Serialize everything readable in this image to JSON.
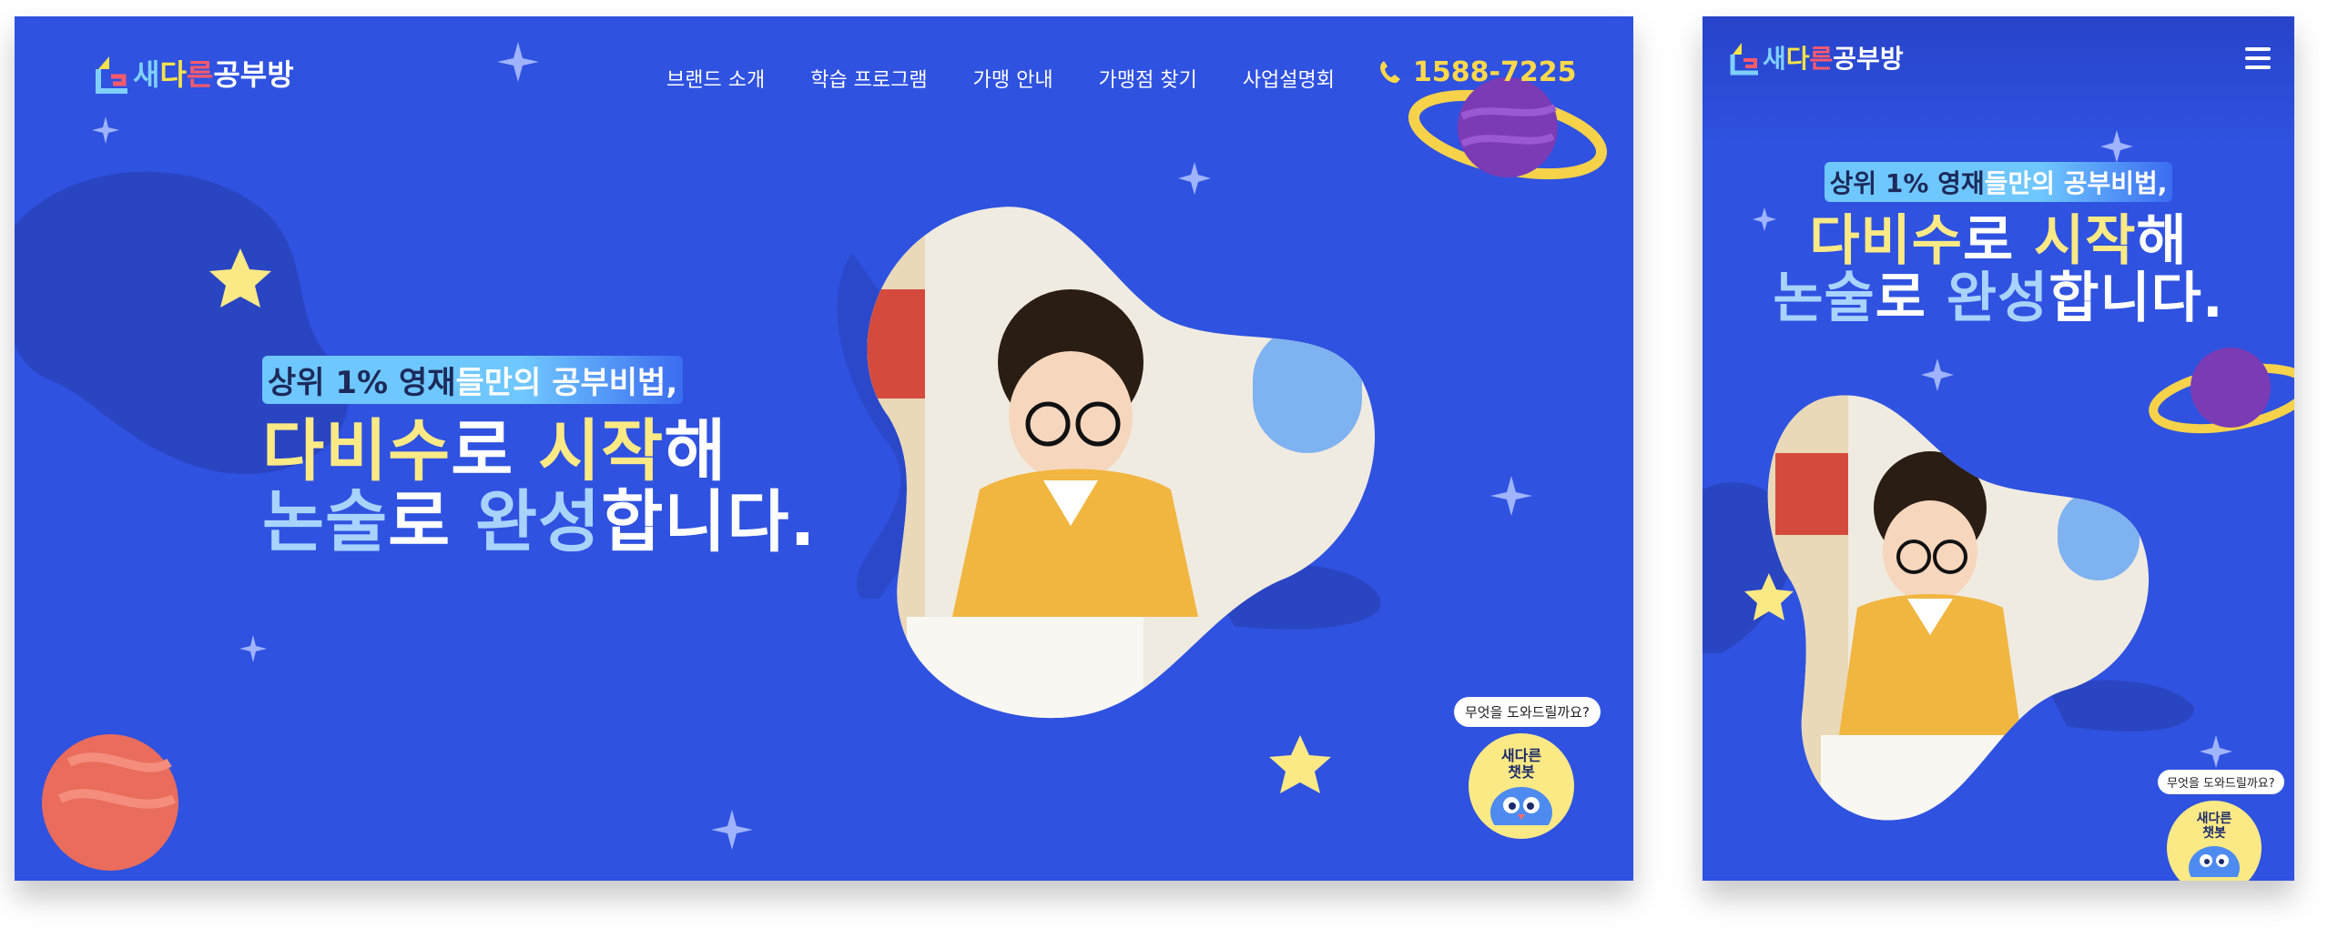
{
  "brand": {
    "logo_sae": "새",
    "logo_da": "다",
    "logo_reun": "른",
    "logo_rest": "공부방"
  },
  "nav": [
    "브랜드 소개",
    "학습 프로그램",
    "가맹 안내",
    "가맹점 찾기",
    "사업설명회"
  ],
  "phone": "1588-7225",
  "hero": {
    "tag_dark": "상위 1% 영재",
    "tag_light": "들만의 공부비법,",
    "line1_a": "다비수",
    "line1_b": "로 ",
    "line1_c": "시작",
    "line1_d": "해",
    "line2_a": "논술",
    "line2_b": "로 ",
    "line2_c": "완성",
    "line2_d": "합니다."
  },
  "chatbot": {
    "question": "무엇을 도와드릴까요?",
    "name_line1": "새다른",
    "name_line2": "챗봇"
  },
  "colors": {
    "background": "#2f52e0",
    "accent_yellow": "#fbe985",
    "accent_blue": "#a9d3ff",
    "phone": "#ffd94a"
  },
  "icons": [
    "logo-house-icon",
    "phone-icon",
    "hamburger-menu-icon",
    "star-icon",
    "sparkle-icon",
    "planet-icon"
  ]
}
